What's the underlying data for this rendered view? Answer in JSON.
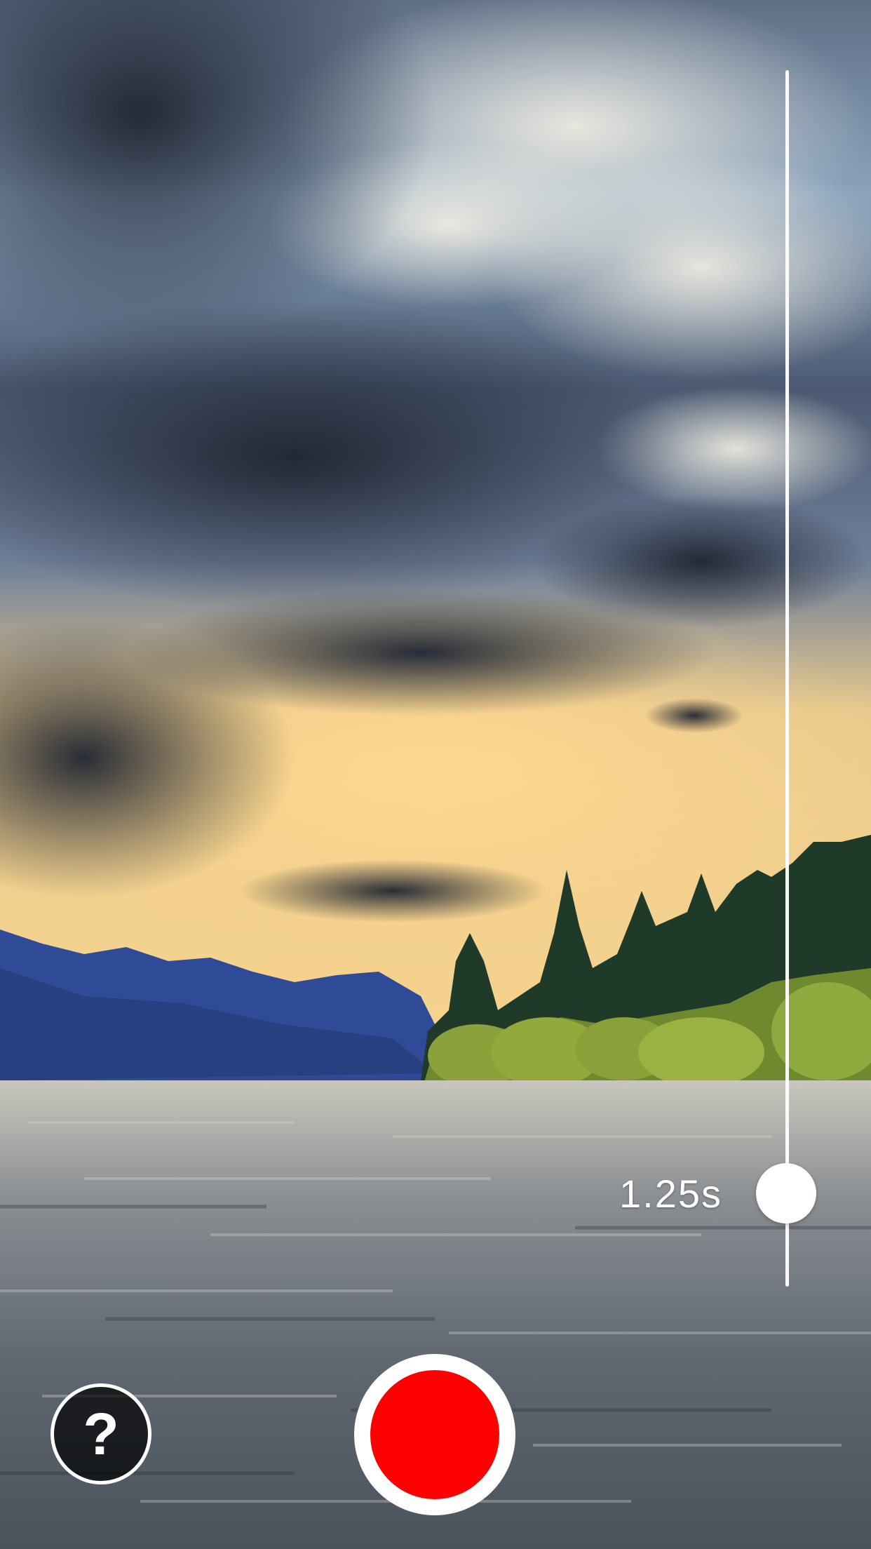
{
  "camera": {
    "shutter_speed": "1.25s",
    "shutter_slider_level": 0.92,
    "help_symbol": "?",
    "record_color": "#ff0000"
  },
  "icons": {
    "help": "question-mark-icon",
    "record": "record-icon"
  }
}
